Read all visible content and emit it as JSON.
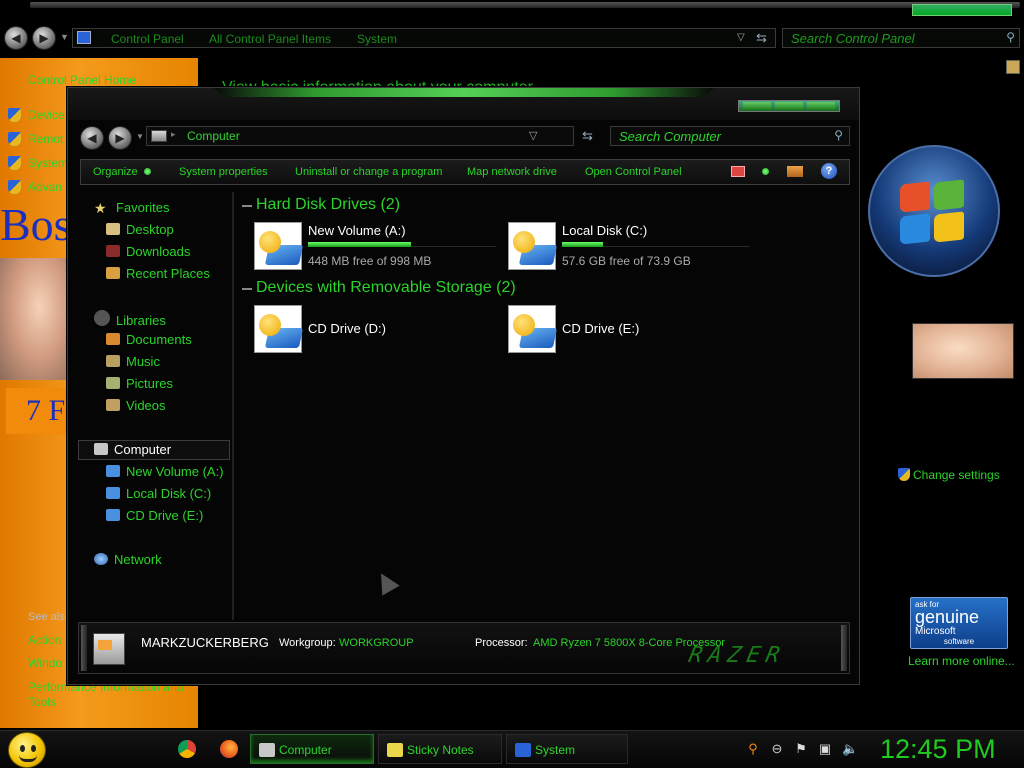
{
  "background_window": {
    "breadcrumb": [
      "Control Panel",
      "All Control Panel Items",
      "System"
    ],
    "search_placeholder": "Search Control Panel",
    "sidebar": {
      "home": "Control Panel Home",
      "links": [
        "Device",
        "Remot",
        "System",
        "Advan"
      ],
      "see_also": "See also",
      "see_also_links": [
        "Action",
        "Windo",
        "Performance Information and",
        "Tools"
      ]
    },
    "heading": "View basic information about your computer",
    "bos_text": "Bos",
    "seven_f": "7 F",
    "change_settings": "Change settings",
    "genuine": {
      "line1": "ask for",
      "line2": "genuine",
      "line3": "Microsoft",
      "line4": "software"
    },
    "learn_more": "Learn more online..."
  },
  "explorer": {
    "address": "Computer",
    "search_placeholder": "Search Computer",
    "toolbar": {
      "organize": "Organize",
      "system_properties": "System properties",
      "uninstall": "Uninstall or change a program",
      "map_drive": "Map network drive",
      "open_cp": "Open Control Panel",
      "help": "?"
    },
    "nav": {
      "favorites": "Favorites",
      "desktop": "Desktop",
      "downloads": "Downloads",
      "recent": "Recent Places",
      "libraries": "Libraries",
      "documents": "Documents",
      "music": "Music",
      "pictures": "Pictures",
      "videos": "Videos",
      "computer": "Computer",
      "new_volume": "New Volume (A:)",
      "local_disk": "Local Disk (C:)",
      "cd_drive": "CD Drive (E:)",
      "network": "Network"
    },
    "groups": {
      "hdd": "Hard Disk Drives (2)",
      "removable": "Devices with Removable Storage (2)"
    },
    "drives": [
      {
        "name": "New Volume (A:)",
        "free": "448 MB free of 998 MB",
        "used_fraction": 0.55
      },
      {
        "name": "Local Disk (C:)",
        "free": "57.6 GB free of 73.9 GB",
        "used_fraction": 0.22
      },
      {
        "name": "CD Drive (D:)"
      },
      {
        "name": "CD Drive (E:)"
      }
    ],
    "details": {
      "computer_name": "MARKZUCKERBERG",
      "workgroup_label": "Workgroup:",
      "workgroup": "WORKGROUP",
      "processor_label": "Processor:",
      "processor": "AMD Ryzen 7 5800X 8-Core Processor",
      "logo": "RAZER"
    }
  },
  "taskbar": {
    "tasks": [
      "Computer",
      "Sticky Notes",
      "System"
    ],
    "clock": "12:45 PM"
  },
  "colors": {
    "accent_green": "#2bd42b",
    "sidebar_orange": "#f49a1c"
  }
}
